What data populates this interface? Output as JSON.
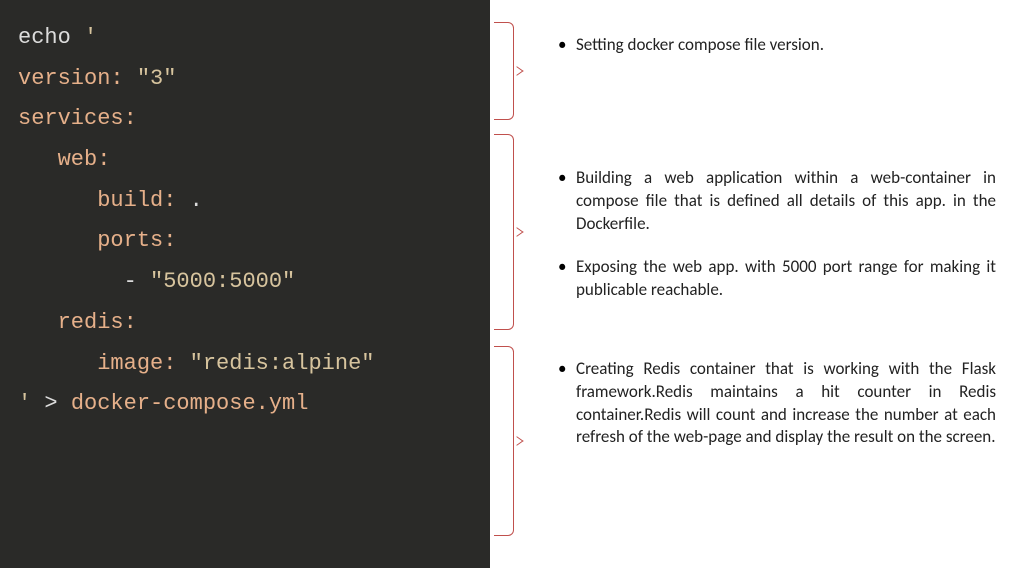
{
  "code": {
    "l1_echo": "echo ",
    "l1_q": "'",
    "l2_key": "version:",
    "l2_val": " \"3\"",
    "l3_key": "services:",
    "l4_key": "web:",
    "l5_key": "build:",
    "l5_val": " .",
    "l6_key": "ports:",
    "l7_dash": "- ",
    "l7_val": "\"5000:5000\"",
    "l8_key": "redis:",
    "l9_key": "image:",
    "l9_val": " \"redis:alpine\"",
    "l10_q": "' ",
    "l10_gt": "> ",
    "l10_file": "docker-compose.yml"
  },
  "notes": {
    "g1": {
      "b1": "Setting  docker compose  file version."
    },
    "g2": {
      "b1": "Building a web application within a web-container in compose file that is defined all details of this app. in the Dockerfile.",
      "b2": "Exposing the web app. with 5000 port range for making it publicable reachable."
    },
    "g3": {
      "b1": "Creating   Redis container that is working with the Flask framework.Redis maintains a hit counter in Redis container.Redis will count and increase the number at each  refresh of the web-page and display the result on the screen."
    }
  }
}
